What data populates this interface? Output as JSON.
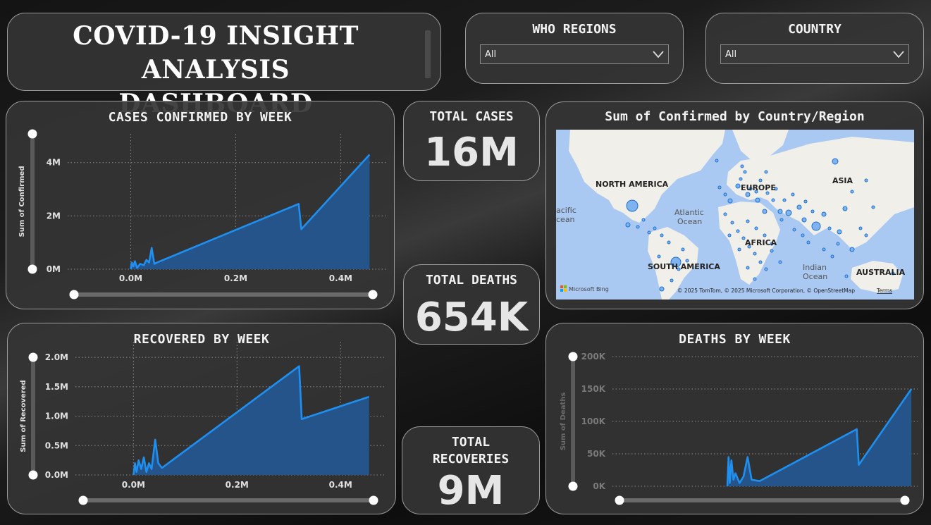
{
  "header": {
    "title_line1": "COVID-19  INSIGHT ANALYSIS",
    "title_line2": "DASHBOARD"
  },
  "filters": {
    "who_regions": {
      "label": "WHO REGIONS",
      "value": "All"
    },
    "country": {
      "label": "COUNTRY",
      "value": "All"
    }
  },
  "kpis": {
    "total_cases": {
      "label": "TOTAL CASES",
      "value": "16M"
    },
    "total_deaths": {
      "label": "TOTAL DEATHS",
      "value": "654K"
    },
    "total_recoveries": {
      "label_line1": "TOTAL",
      "label_line2": "RECOVERIES",
      "value": "9M"
    }
  },
  "map": {
    "title": "Sum of Confirmed by Country/Region",
    "labels": {
      "north_america": "NORTH AMERICA",
      "south_america": "SOUTH AMERICA",
      "europe": "EUROPE",
      "asia": "ASIA",
      "africa": "AFRICA",
      "australia": "AUSTRALIA",
      "atlantic": "Atlantic",
      "atlantic2": "Ocean",
      "pacific": "acific",
      "pacific2": "cean",
      "indian": "Indian",
      "indian2": "Ocean"
    },
    "attribution": "© 2025 TomTom, © 2025 Microsoft Corporation, © OpenStreetMap",
    "terms": "Terms",
    "logo": "Microsoft Bing",
    "colors": {
      "water": "#a9c8f2",
      "land": "#f0efe9",
      "bubble": "#3c8ee6"
    }
  },
  "chart_data": [
    {
      "id": "confirmed",
      "type": "area",
      "title": "CASES CONFIRMED BY WEEK",
      "ylabel": "Sum of Confirmed",
      "xlim": [
        -0.01,
        0.48
      ],
      "ylim": [
        0,
        4.6
      ],
      "xticks": [
        0.0,
        0.2,
        0.4
      ],
      "xtick_labels": [
        "0.0M",
        "0.2M",
        "0.4M"
      ],
      "yticks": [
        0,
        2,
        4
      ],
      "ytick_labels": [
        "0M",
        "2M",
        "4M"
      ],
      "points": [
        [
          0.0,
          0.0
        ],
        [
          0.002,
          0.25
        ],
        [
          0.005,
          0.1
        ],
        [
          0.008,
          0.3
        ],
        [
          0.012,
          0.05
        ],
        [
          0.018,
          0.2
        ],
        [
          0.025,
          0.15
        ],
        [
          0.03,
          0.35
        ],
        [
          0.035,
          0.25
        ],
        [
          0.04,
          0.8
        ],
        [
          0.045,
          0.2
        ],
        [
          0.05,
          0.25
        ],
        [
          0.32,
          2.45
        ],
        [
          0.325,
          1.5
        ],
        [
          0.455,
          4.3
        ]
      ],
      "color": "#1f8ff0",
      "fill": "#24548a"
    },
    {
      "id": "recovered",
      "type": "area",
      "title": "RECOVERED BY WEEK",
      "ylabel": "Sum of Recovered",
      "xlim": [
        -0.01,
        0.48
      ],
      "ylim": [
        0,
        2.05
      ],
      "xticks": [
        0.0,
        0.2,
        0.4
      ],
      "xtick_labels": [
        "0.0M",
        "0.2M",
        "0.4M"
      ],
      "yticks": [
        0,
        0.5,
        1.0,
        1.5,
        2.0
      ],
      "ytick_labels": [
        "0.0M",
        "0.5M",
        "1.0M",
        "1.5M",
        "2.0M"
      ],
      "points": [
        [
          0.0,
          0.0
        ],
        [
          0.003,
          0.2
        ],
        [
          0.006,
          0.05
        ],
        [
          0.01,
          0.25
        ],
        [
          0.015,
          0.1
        ],
        [
          0.02,
          0.3
        ],
        [
          0.025,
          0.05
        ],
        [
          0.03,
          0.2
        ],
        [
          0.035,
          0.1
        ],
        [
          0.042,
          0.6
        ],
        [
          0.048,
          0.2
        ],
        [
          0.055,
          0.12
        ],
        [
          0.32,
          1.85
        ],
        [
          0.325,
          0.95
        ],
        [
          0.455,
          1.33
        ]
      ],
      "color": "#1f8ff0",
      "fill": "#24548a"
    },
    {
      "id": "deaths",
      "type": "area",
      "title": "DEATHS BY WEEK",
      "ylabel": "Sum of Deaths",
      "xlim": [
        -0.15,
        0.46
      ],
      "ylim": [
        0,
        200
      ],
      "xticks": [],
      "xtick_labels": [],
      "yticks": [
        0,
        50,
        100,
        150,
        200
      ],
      "ytick_labels": [
        "0K",
        "50K",
        "100K",
        "150K",
        "200K"
      ],
      "points": [
        [
          0.0,
          0.0
        ],
        [
          0.003,
          45
        ],
        [
          0.006,
          5
        ],
        [
          0.01,
          40
        ],
        [
          0.015,
          10
        ],
        [
          0.02,
          20
        ],
        [
          0.03,
          5
        ],
        [
          0.04,
          15
        ],
        [
          0.05,
          45
        ],
        [
          0.06,
          10
        ],
        [
          0.08,
          8
        ],
        [
          0.32,
          88
        ],
        [
          0.325,
          33
        ],
        [
          0.455,
          150
        ]
      ],
      "color": "#1f8ff0",
      "fill": "#24548a"
    }
  ]
}
